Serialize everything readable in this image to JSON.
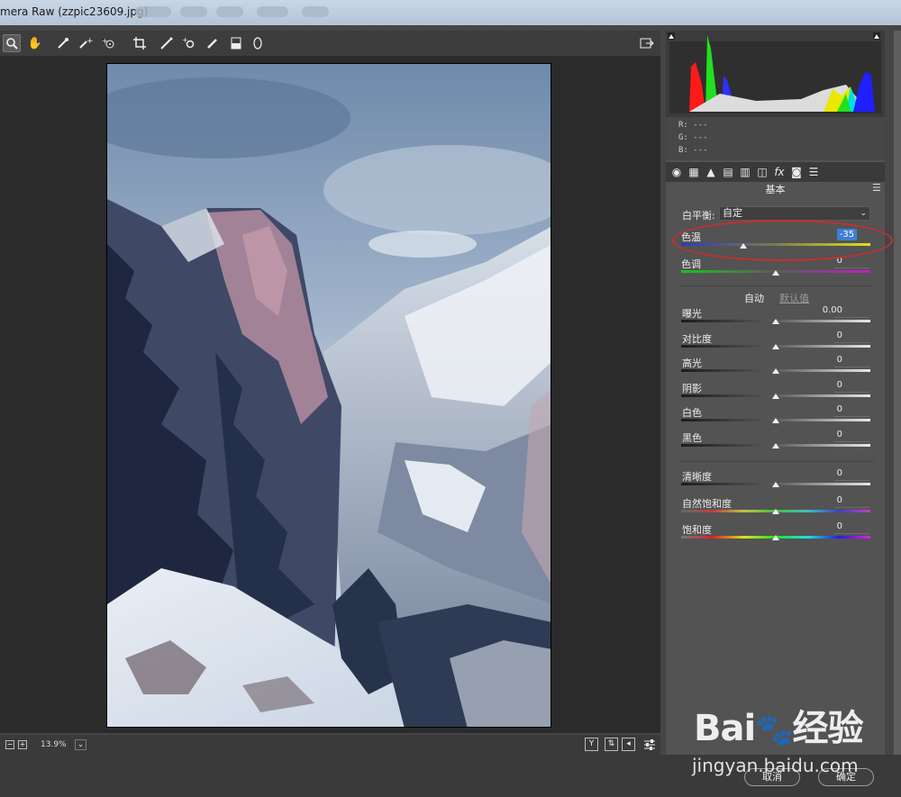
{
  "window": {
    "title": "mera Raw (zzpic23609.jpg)"
  },
  "toolbar": {
    "tools": [
      "zoom-icon",
      "hand-icon",
      "white-balance-icon",
      "color-sampler-icon",
      "target-adjust-icon",
      "crop-icon",
      "straighten-icon",
      "spot-removal-icon",
      "red-eye-icon",
      "brush-icon",
      "graduated-filter-icon",
      "radial-filter-icon"
    ]
  },
  "histogram": {
    "r": "R:  ---",
    "g": "G:  ---",
    "b": "B:  ---"
  },
  "panel": {
    "section": "基本",
    "wb_label": "白平衡:",
    "wb_value": "自定",
    "temp": {
      "label": "色温",
      "value": "-35",
      "position": 0.33
    },
    "tint": {
      "label": "色调",
      "value": "0",
      "position": 0.5
    },
    "auto": "自动",
    "default": "默认值",
    "sliders": [
      {
        "label": "曝光",
        "value": "0.00",
        "position": 0.5
      },
      {
        "label": "对比度",
        "value": "0",
        "position": 0.5
      },
      {
        "label": "高光",
        "value": "0",
        "position": 0.5
      },
      {
        "label": "阴影",
        "value": "0",
        "position": 0.5
      },
      {
        "label": "白色",
        "value": "0",
        "position": 0.5
      },
      {
        "label": "黑色",
        "value": "0",
        "position": 0.5
      }
    ],
    "presence": [
      {
        "label": "清晰度",
        "value": "0",
        "position": 0.5
      },
      {
        "label": "自然饱和度",
        "value": "0",
        "position": 0.5
      },
      {
        "label": "饱和度",
        "value": "0",
        "position": 0.5
      }
    ]
  },
  "bottom": {
    "zoom": "13.9%"
  },
  "footer": {
    "cancel": "取消",
    "ok": "确定"
  },
  "watermark": {
    "brand": "Bai du 经验",
    "url": "jingyan.baidu.com"
  }
}
